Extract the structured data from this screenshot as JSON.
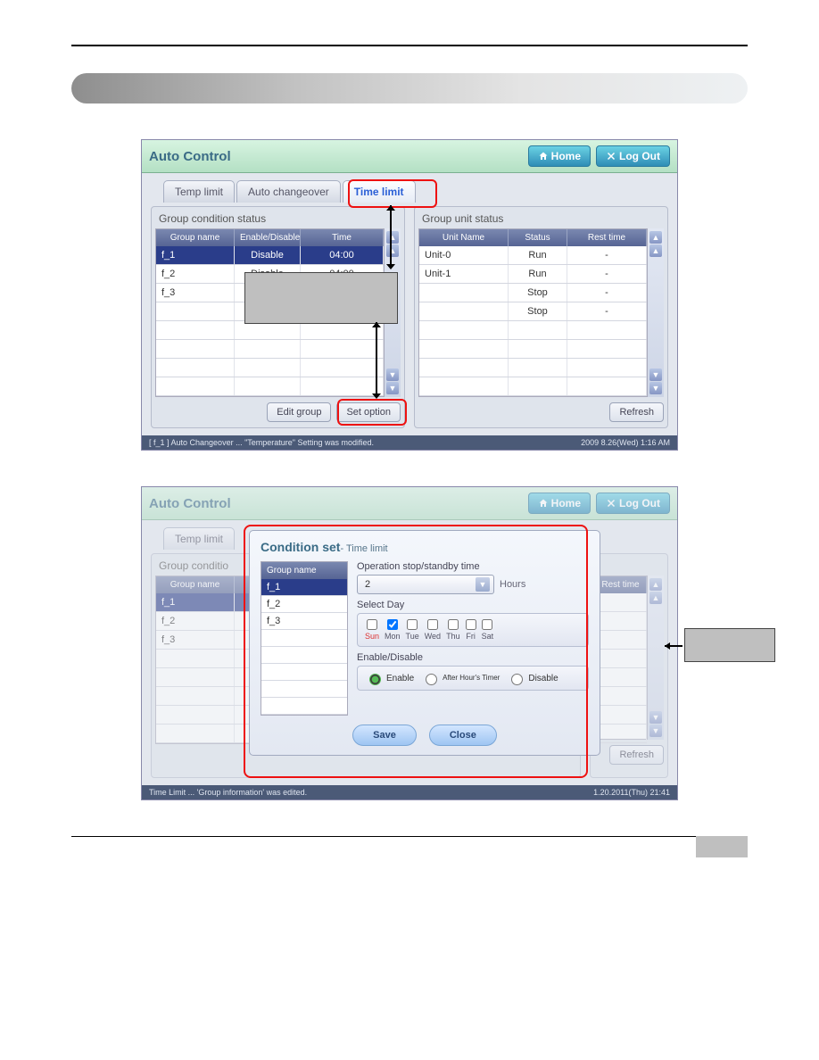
{
  "section_title": "Auto Control",
  "header": {
    "home": "Home",
    "logout": "Log Out"
  },
  "tabs": {
    "temp": "Temp limit",
    "auto": "Auto changeover",
    "time": "Time limit"
  },
  "panel_a_title": "Group condition status",
  "panel_b_title": "Group unit status",
  "cols_a": {
    "c1": "Group name",
    "c2": "Enable/Disable",
    "c3": "Time"
  },
  "cols_b": {
    "c1": "Unit Name",
    "c2": "Status",
    "c3": "Rest time"
  },
  "rows_a": [
    {
      "name": "f_1",
      "ed": "Disable",
      "time": "04:00",
      "selected": true
    },
    {
      "name": "f_2",
      "ed": "Disable",
      "time": "04:00"
    },
    {
      "name": "f_3",
      "ed": "",
      "time": ""
    },
    {
      "name": "",
      "ed": "",
      "time": ""
    },
    {
      "name": "",
      "ed": "",
      "time": ""
    },
    {
      "name": "",
      "ed": "",
      "time": ""
    },
    {
      "name": "",
      "ed": "",
      "time": ""
    },
    {
      "name": "",
      "ed": "",
      "time": ""
    }
  ],
  "rows_b": [
    {
      "name": "Unit-0",
      "st": "Run",
      "rt": "-"
    },
    {
      "name": "Unit-1",
      "st": "Run",
      "rt": "-"
    },
    {
      "name": "",
      "st": "Stop",
      "rt": "-"
    },
    {
      "name": "",
      "st": "Stop",
      "rt": "-"
    },
    {
      "name": "",
      "st": "",
      "rt": ""
    },
    {
      "name": "",
      "st": "",
      "rt": ""
    },
    {
      "name": "",
      "st": "",
      "rt": ""
    },
    {
      "name": "",
      "st": "",
      "rt": ""
    }
  ],
  "buttons": {
    "edit": "Edit group",
    "setopt": "Set option",
    "refresh": "Refresh"
  },
  "status1": {
    "left": "[ f_1 ] Auto Changeover ... \"Temperature\" Setting was modified.",
    "right": "2009 8.26(Wed)  1:16 AM"
  },
  "status2": {
    "left": "Time Limit ... 'Group information' was edited.",
    "right": "1.20.2011(Thu)  21:41"
  },
  "dialog": {
    "title": "Condition set",
    "sub": "- Time limit",
    "grp_col": "Group name",
    "groups": [
      "f_1",
      "f_2",
      "f_3"
    ],
    "op_label": "Operation stop/standby time",
    "op_value": "2",
    "op_unit": "Hours",
    "day_label": "Select Day",
    "days": [
      "Sun",
      "Mon",
      "Tue",
      "Wed",
      "Thu",
      "Fri",
      "Sat"
    ],
    "days_checked": [
      false,
      true,
      false,
      false,
      false,
      false,
      false
    ],
    "ed_label": "Enable/Disable",
    "ed_opts": {
      "en": "Enable",
      "ah": "After Hour's\nTimer",
      "dis": "Disable"
    },
    "save": "Save",
    "close": "Close"
  }
}
